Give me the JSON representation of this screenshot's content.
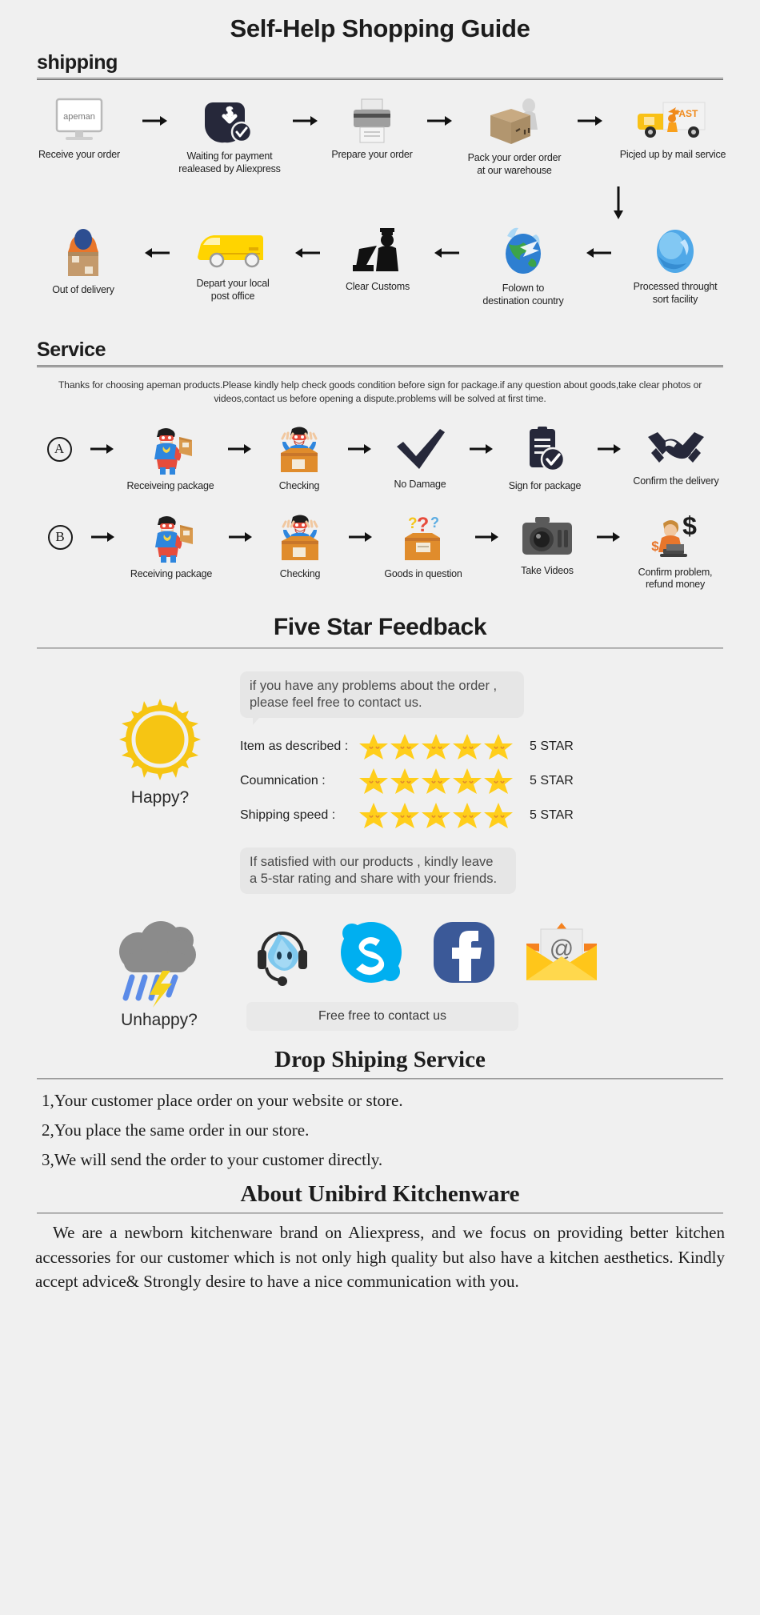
{
  "page": {
    "title": "Self-Help Shopping Guide",
    "bg": "#f0f0f0"
  },
  "shipping": {
    "heading": "shipping",
    "row1": [
      {
        "caption": "Receive your order",
        "icon": "monitor-apeman-icon"
      },
      {
        "caption": "Waiting for payment\nrealeased by Aliexpress",
        "icon": "payment-shield-dollar-icon"
      },
      {
        "caption": "Prepare your order",
        "icon": "printer-icon"
      },
      {
        "caption": "Pack your order order\nat our warehouse",
        "icon": "packing-box-worker-icon"
      },
      {
        "caption": "Picjed up by mail service",
        "icon": "fast-delivery-truck-icon"
      }
    ],
    "row2": [
      {
        "caption": "Out of delivery",
        "icon": "courier-carrying-box-icon"
      },
      {
        "caption": "Depart your local\npost office",
        "icon": "yellow-van-icon"
      },
      {
        "caption": "Clear Customs",
        "icon": "customs-officer-icon"
      },
      {
        "caption": "Folown to\ndestination country",
        "icon": "globe-airplane-icon"
      },
      {
        "caption": "Processed throught\nsort facility",
        "icon": "blue-sphere-sort-icon"
      }
    ]
  },
  "service": {
    "heading": "Service",
    "note": "Thanks for choosing apeman products.Please kindly help check goods condition before sign for package.if any question about goods,take clear photos or videos,contact us before opening a dispute.problems will be solved at first time.",
    "rowA": {
      "badge": "A",
      "steps": [
        {
          "caption": "Receiveing package",
          "icon": "hero-holding-package-icon"
        },
        {
          "caption": "Checking",
          "icon": "hero-opening-box-icon"
        },
        {
          "caption": "No Damage",
          "icon": "check-mark-icon"
        },
        {
          "caption": "Sign for package",
          "icon": "signed-document-icon"
        },
        {
          "caption": "Confirm the delivery",
          "icon": "handshake-icon"
        }
      ]
    },
    "rowB": {
      "badge": "B",
      "steps": [
        {
          "caption": "Receiving package",
          "icon": "hero-holding-package-icon"
        },
        {
          "caption": "Checking",
          "icon": "hero-opening-box-icon"
        },
        {
          "caption": "Goods in question",
          "icon": "question-box-icon"
        },
        {
          "caption": "Take Videos",
          "icon": "camera-icon"
        },
        {
          "caption": "Confirm problem,\nrefund money",
          "icon": "refund-agent-dollar-icon"
        }
      ]
    }
  },
  "feedback": {
    "heading": "Five Star Feedback",
    "happy_label": "Happy?",
    "happy_icon": "sun-icon",
    "bubble_text": "if you have any problems about the order ,\nplease feel free to contact us.",
    "ratings": [
      {
        "label": "Item as described :",
        "stars": 5,
        "value": "5 STAR"
      },
      {
        "label": "Coumnication :",
        "stars": 5,
        "value": "5 STAR"
      },
      {
        "label": "Shipping speed :",
        "stars": 5,
        "value": "5 STAR"
      }
    ],
    "satisfied_text": "If satisfied with our products ,  kindly leave\na 5-star rating and share with your friends.",
    "unhappy_label": "Unhappy?",
    "unhappy_icon": "rain-cloud-lightning-icon",
    "contact_channels": [
      {
        "name": "live-chat-headset-icon"
      },
      {
        "name": "skype-icon"
      },
      {
        "name": "facebook-icon"
      },
      {
        "name": "email-envelope-icon"
      }
    ],
    "contact_bar": "Free free to contact us",
    "star_color": "#FFCE1B",
    "skype_color": "#00AFF0",
    "facebook_color": "#3b5998",
    "sun_color": "#F6C513"
  },
  "dropshipping": {
    "heading": "Drop Shiping Service",
    "steps": [
      "1,Your customer place order on your website or store.",
      "2,You place the same order in our store.",
      "3,We will send the order to your customer directly."
    ]
  },
  "about": {
    "heading": "About Unibird Kitchenware",
    "body": "We are a newborn kitchenware brand on Aliexpress, and we focus on providing better kitchen accessories for our customer which is not only high quality but also have a kitchen aesthetics. Kindly accept advice& Strongly desire to have a nice communication with you."
  }
}
